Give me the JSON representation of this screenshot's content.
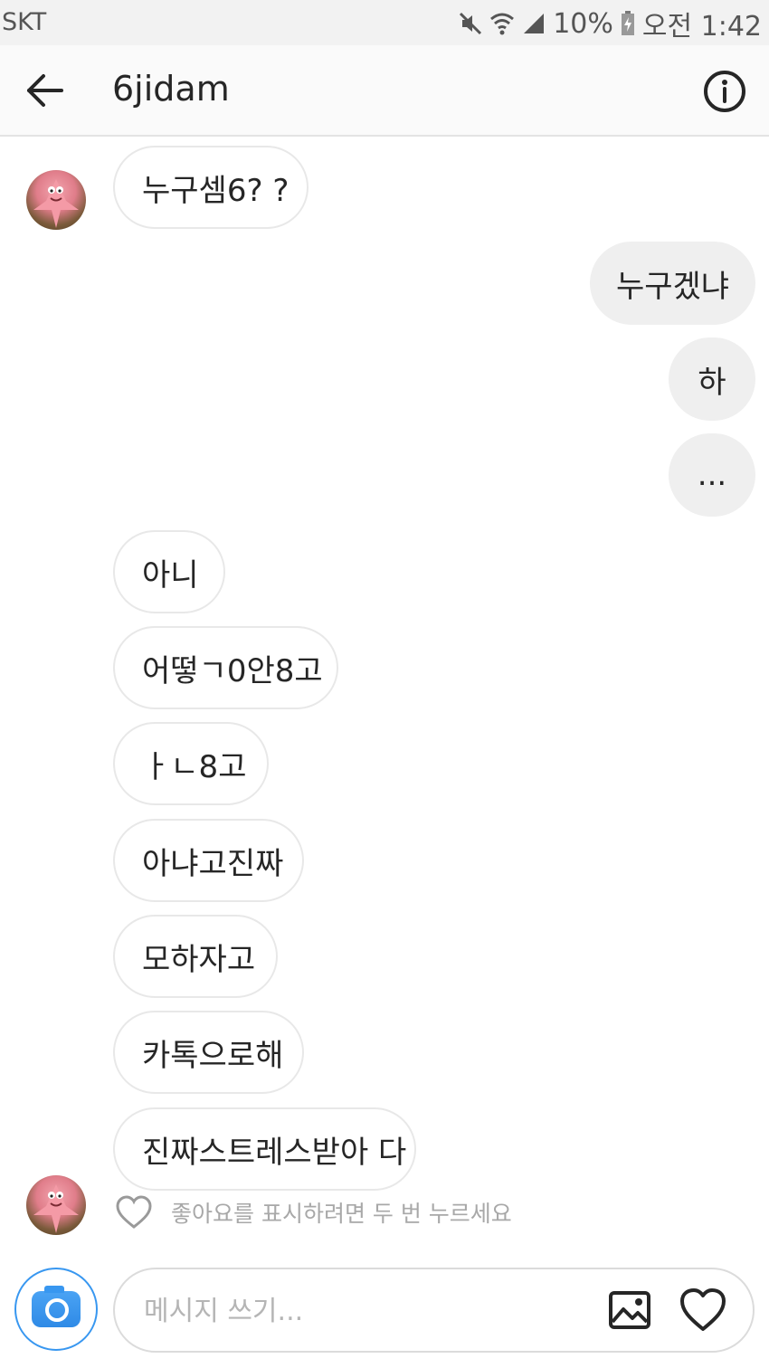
{
  "status_bar": {
    "carrier": "SKT",
    "battery": "10%",
    "time": "오전 1:42",
    "icons": [
      "mute-icon",
      "wifi-icon",
      "signal-icon",
      "battery-icon"
    ]
  },
  "header": {
    "title": "6jidam",
    "icons": [
      "back-arrow-icon",
      "info-icon"
    ]
  },
  "messages": [
    {
      "from": "them",
      "text": "누구셈6? ?"
    },
    {
      "from": "me",
      "text": "누구겠냐"
    },
    {
      "from": "me",
      "text": "하"
    },
    {
      "from": "me",
      "text": "..."
    },
    {
      "from": "them",
      "text": "아니"
    },
    {
      "from": "them",
      "text": "어떻ㄱ0안8고"
    },
    {
      "from": "them",
      "text": "ㅏㄴ8고"
    },
    {
      "from": "them",
      "text": "아냐고진짜"
    },
    {
      "from": "them",
      "text": "모하자고"
    },
    {
      "from": "them",
      "text": "카톡으로해"
    },
    {
      "from": "them",
      "text": "진짜스트레스받아 다"
    }
  ],
  "like_hint": "좋아요를 표시하려면 두 번 누르세요",
  "composer": {
    "placeholder": "메시지 쓰기...",
    "icons": [
      "camera-icon",
      "gallery-icon",
      "heart-icon"
    ]
  },
  "colors": {
    "accent": "#3897f0",
    "outgoing_bubble": "#efefef",
    "incoming_border": "#e8e8e8"
  }
}
